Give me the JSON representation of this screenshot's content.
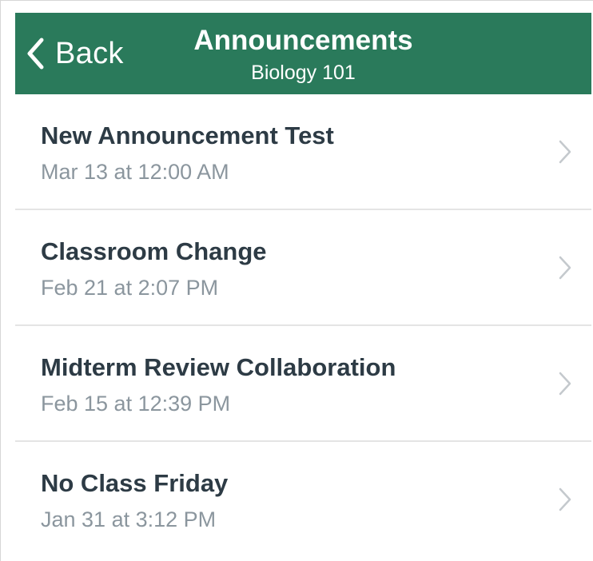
{
  "navbar": {
    "back_label": "Back",
    "title": "Announcements",
    "subtitle": "Biology 101",
    "background_color": "#2a7a5b"
  },
  "announcements": [
    {
      "title": "New Announcement Test",
      "date": "Mar 13 at 12:00 AM"
    },
    {
      "title": "Classroom Change",
      "date": "Feb 21 at 2:07 PM"
    },
    {
      "title": "Midterm Review Collaboration",
      "date": "Feb 15 at 12:39 PM"
    },
    {
      "title": "No Class Friday",
      "date": "Jan 31 at 3:12 PM"
    }
  ],
  "icons": {
    "back": "chevron-left-icon",
    "row_disclosure": "chevron-right-icon"
  }
}
